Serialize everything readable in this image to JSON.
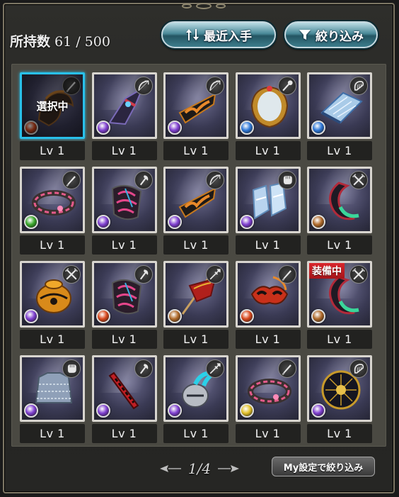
{
  "header": {
    "count_label": "所持数",
    "count_value": "61 / 500",
    "sort_label": "最近入手",
    "filter_label": "絞り込み"
  },
  "grid": {
    "items": [
      {
        "level": "Lv 1",
        "weapon": "knife-icon",
        "element": "fire",
        "art": "dark-helm",
        "selected": true,
        "selected_label": "選択中"
      },
      {
        "level": "Lv 1",
        "weapon": "bow-icon",
        "element": "dark",
        "art": "dark-wing"
      },
      {
        "level": "Lv 1",
        "weapon": "bow-icon",
        "element": "dark",
        "art": "flame-banner"
      },
      {
        "level": "Lv 1",
        "weapon": "staff-icon",
        "element": "water",
        "art": "gold-mirror"
      },
      {
        "level": "Lv 1",
        "weapon": "harp-icon",
        "element": "water",
        "art": "harp"
      },
      {
        "level": "Lv 1",
        "weapon": "knife-icon",
        "element": "wind",
        "art": "pink-ring"
      },
      {
        "level": "Lv 1",
        "weapon": "axe-icon",
        "element": "dark",
        "art": "pink-shield"
      },
      {
        "level": "Lv 1",
        "weapon": "bow-icon",
        "element": "dark",
        "art": "flame-banner"
      },
      {
        "level": "Lv 1",
        "weapon": "fist-icon",
        "element": "dark",
        "art": "ice-boots"
      },
      {
        "level": "Lv 1",
        "weapon": "sword-icon",
        "element": "earth",
        "art": "crescent"
      },
      {
        "level": "Lv 1",
        "weapon": "sword-icon",
        "element": "dark",
        "art": "gold-chest"
      },
      {
        "level": "Lv 1",
        "weapon": "axe-icon",
        "element": "fire",
        "art": "pink-shield"
      },
      {
        "level": "Lv 1",
        "weapon": "spear-icon",
        "element": "earth",
        "art": "red-flag"
      },
      {
        "level": "Lv 1",
        "weapon": "knife-icon",
        "element": "fire",
        "art": "mask"
      },
      {
        "level": "Lv 1",
        "weapon": "sword-icon",
        "element": "earth",
        "art": "crescent",
        "equipped": true,
        "equipped_label": "装備中"
      },
      {
        "level": "Lv 1",
        "weapon": "fist-icon",
        "element": "dark",
        "art": "chain-mail"
      },
      {
        "level": "Lv 1",
        "weapon": "axe-icon",
        "element": "dark",
        "art": "red-scroll"
      },
      {
        "level": "Lv 1",
        "weapon": "spear-icon",
        "element": "dark",
        "art": "teal-helm"
      },
      {
        "level": "Lv 1",
        "weapon": "knife-icon",
        "element": "light",
        "art": "pink-ring"
      },
      {
        "level": "Lv 1",
        "weapon": "harp-icon",
        "element": "dark",
        "art": "gold-orb"
      }
    ]
  },
  "pager": {
    "label": "1/4"
  },
  "footer": {
    "my_setting_label": "My設定で絞り込み"
  },
  "colors": {
    "fire": "#d9491e",
    "water": "#2f78d8",
    "earth": "#b06a2a",
    "wind": "#3aa82c",
    "light": "#e3c12a",
    "dark": "#7f3fd0"
  }
}
